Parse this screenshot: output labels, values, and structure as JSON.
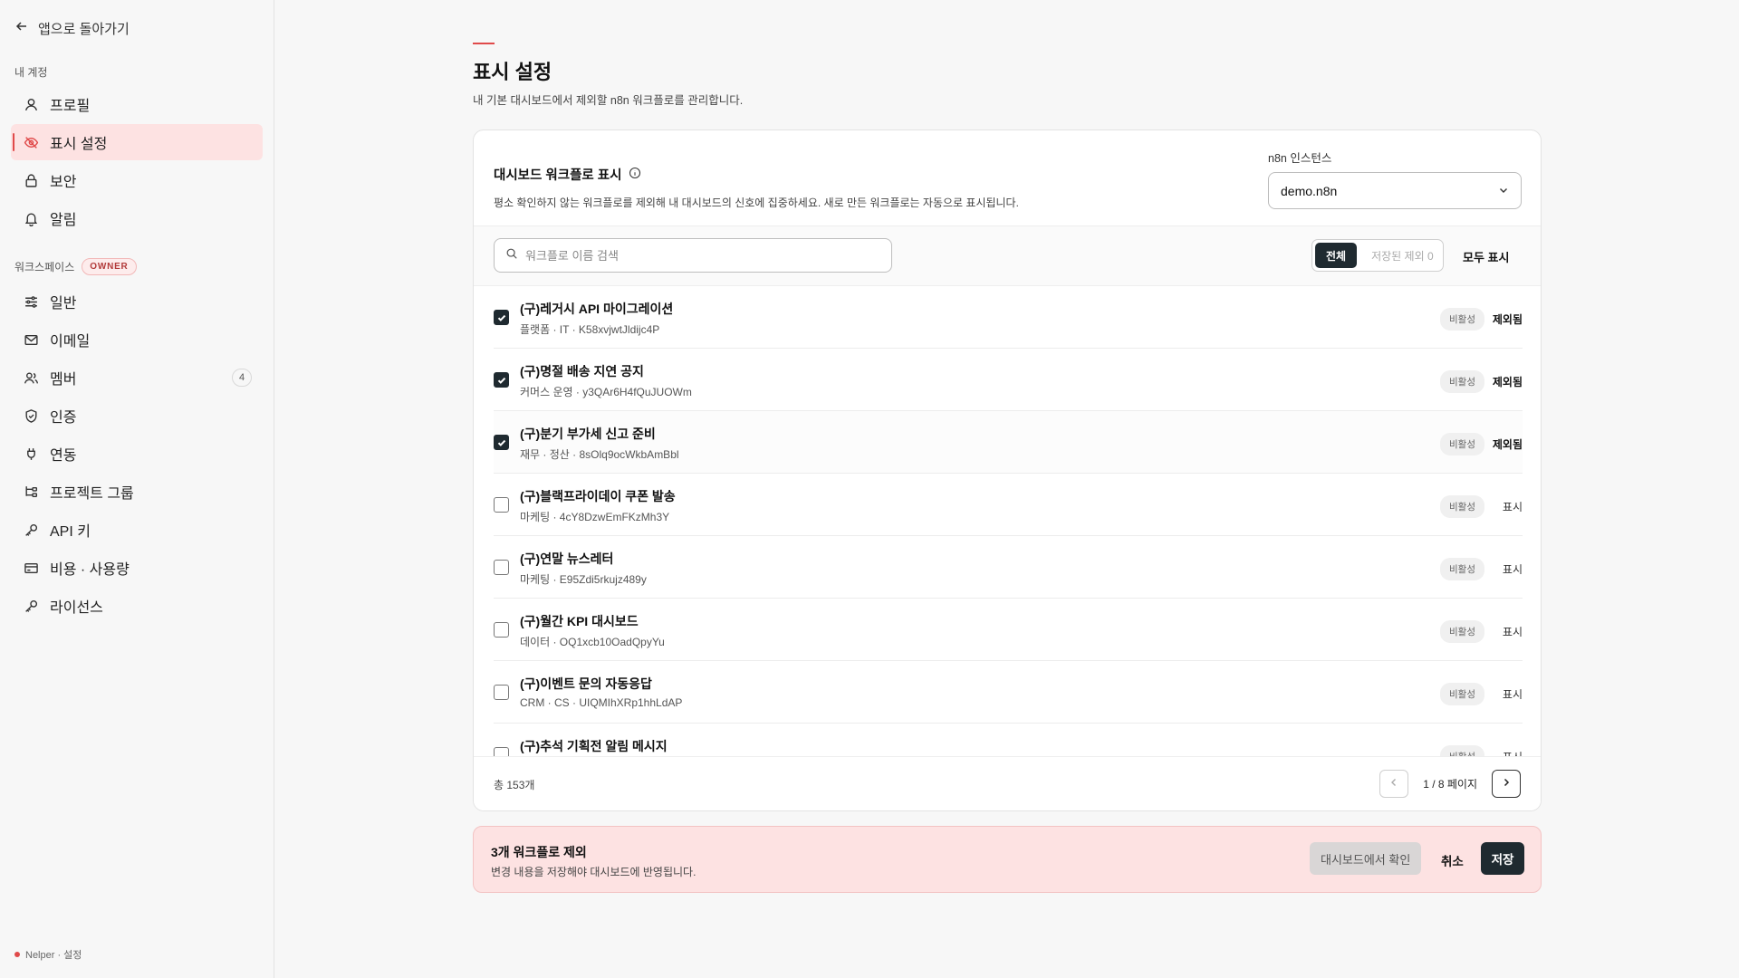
{
  "sidebar": {
    "back_label": "앱으로 돌아가기",
    "account_label": "내 계정",
    "account_items": [
      {
        "label": "프로필",
        "icon": "user-icon"
      },
      {
        "label": "표시 설정",
        "icon": "eye-off-icon",
        "active": true
      },
      {
        "label": "보안",
        "icon": "lock-icon"
      },
      {
        "label": "알림",
        "icon": "bell-icon"
      }
    ],
    "workspace_label": "워크스페이스",
    "owner_badge": "OWNER",
    "workspace_items": [
      {
        "label": "일반",
        "icon": "sliders-icon"
      },
      {
        "label": "이메일",
        "icon": "mail-icon"
      },
      {
        "label": "멤버",
        "icon": "users-icon",
        "count": "4"
      },
      {
        "label": "인증",
        "icon": "shield-icon"
      },
      {
        "label": "연동",
        "icon": "plug-icon"
      },
      {
        "label": "프로젝트 그룹",
        "icon": "tree-icon"
      },
      {
        "label": "API 키",
        "icon": "key-icon"
      },
      {
        "label": "비용 · 사용량",
        "icon": "card-icon"
      },
      {
        "label": "라이선스",
        "icon": "key-icon"
      }
    ],
    "footer": "Nelper · 설정"
  },
  "page": {
    "title": "표시 설정",
    "subtitle": "내 기본 대시보드에서 제외할 n8n 워크플로를 관리합니다."
  },
  "card": {
    "title": "대시보드 워크플로 표시",
    "description": "평소 확인하지 않는 워크플로를 제외해 내 대시보드의 신호에 집중하세요. 새로 만든 워크플로는 자동으로 표시됩니다.",
    "instance_label": "n8n 인스턴스",
    "instance_value": "demo.n8n",
    "search_placeholder": "워크플로 이름 검색",
    "seg_all": "전체",
    "seg_saved": "저장된 제외 0",
    "show_all": "모두 표시",
    "total": "총 153개",
    "page_text": "1 / 8 페이지"
  },
  "rows": [
    {
      "name": "(구)레거시 API 마이그레이션",
      "meta": "플랫폼 · IT · K58xvjwtJldijc4P",
      "status": "비활성",
      "state": "제외됨",
      "checked": true
    },
    {
      "name": "(구)명절 배송 지연 공지",
      "meta": "커머스 운영 · y3QAr6H4fQuJUOWm",
      "status": "비활성",
      "state": "제외됨",
      "checked": true
    },
    {
      "name": "(구)분기 부가세 신고 준비",
      "meta": "재무 · 정산 · 8sOlq9ocWkbAmBbl",
      "status": "비활성",
      "state": "제외됨",
      "checked": true
    },
    {
      "name": "(구)블랙프라이데이 쿠폰 발송",
      "meta": "마케팅 · 4cY8DzwEmFKzMh3Y",
      "status": "비활성",
      "state": "표시",
      "checked": false
    },
    {
      "name": "(구)연말 뉴스레터",
      "meta": "마케팅 · E95Zdi5rkujz489y",
      "status": "비활성",
      "state": "표시",
      "checked": false
    },
    {
      "name": "(구)월간 KPI 대시보드",
      "meta": "데이터 · OQ1xcb10OadQpyYu",
      "status": "비활성",
      "state": "표시",
      "checked": false
    },
    {
      "name": "(구)이벤트 문의 자동응답",
      "meta": "CRM · CS · UIQMIhXRp1hhLdAP",
      "status": "비활성",
      "state": "표시",
      "checked": false
    },
    {
      "name": "(구)추석 기획전 알림 메시지",
      "meta": "",
      "status": "비활성",
      "state": "표시",
      "checked": false
    }
  ],
  "banner": {
    "title": "3개 워크플로 제외",
    "subtitle": "변경 내용을 저장해야 대시보드에 반영됩니다.",
    "preview_label": "대시보드에서 확인",
    "cancel_label": "취소",
    "save_label": "저장"
  },
  "colors": {
    "accent": "#e04a4a",
    "active_bg": "#fde2e2",
    "dark": "#1f2a30"
  }
}
